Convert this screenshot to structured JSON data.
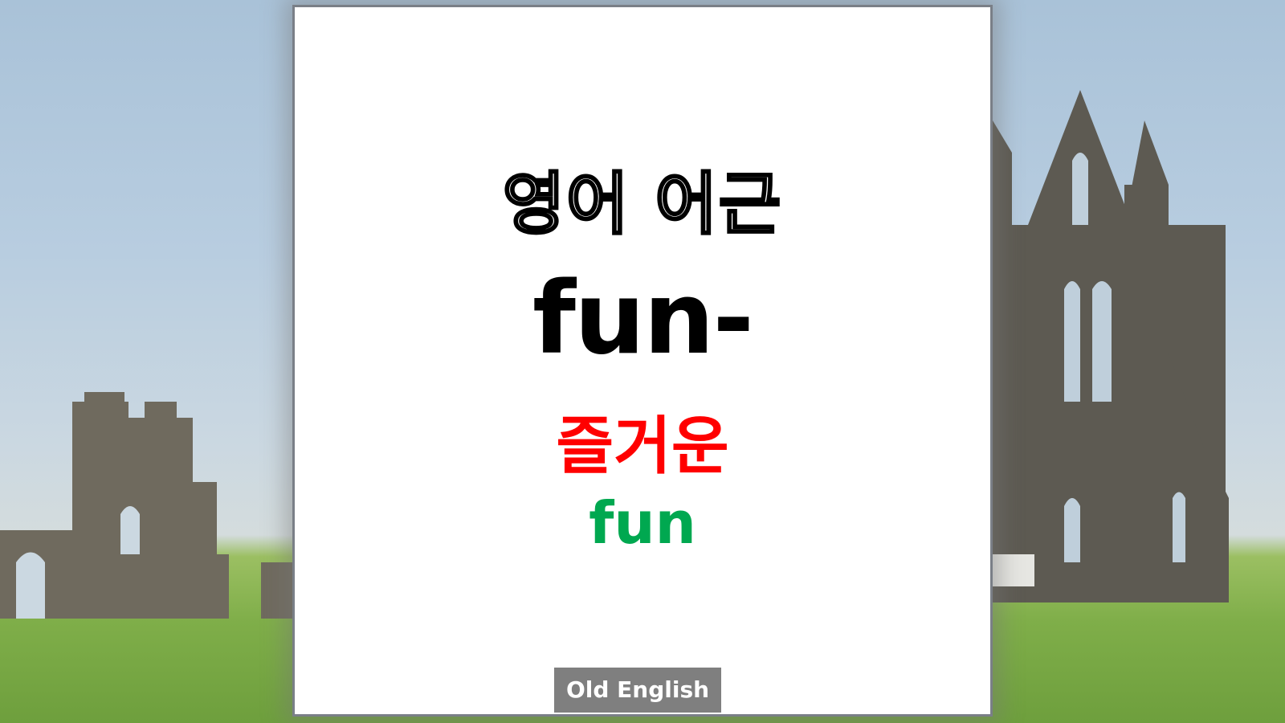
{
  "slide": {
    "title": "영어 어근",
    "root": "fun-",
    "meaning": "즐거운",
    "example_word": "fun",
    "origin_tag": "Old English"
  },
  "colors": {
    "title_outline": "#000000",
    "root": "#000000",
    "meaning": "#ff0000",
    "example_word": "#00a850",
    "tag_background": "#7f7f7f",
    "tag_text": "#ffffff",
    "card_background": "#ffffff"
  },
  "background": {
    "description_icon": "abbey-ruins-photo"
  }
}
